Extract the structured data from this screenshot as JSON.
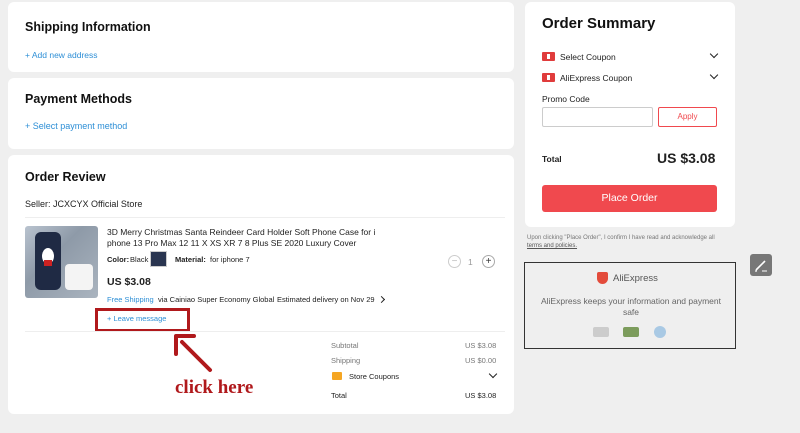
{
  "shipping": {
    "title": "Shipping Information",
    "add_address": "+ Add new address"
  },
  "payment": {
    "title": "Payment Methods",
    "select_method": "+ Select payment method"
  },
  "review": {
    "title": "Order Review",
    "seller": "Seller: JCXCYX Official Store",
    "product": {
      "title_line1": "3D Merry Christmas Santa Reindeer Card Holder Soft Phone Case for i",
      "title_line2": "phone 13 Pro Max 12 11 X XS XR 7 8 Plus SE 2020 Luxury Cover",
      "color_label": "Color:",
      "color_value": "Black",
      "material_label": "Material:",
      "material_value": "for iphone 7",
      "price": "US $3.08",
      "free_shipping": "Free Shipping",
      "shipping_via": "via Cainiao Super Economy Global",
      "delivery": "Estimated delivery on Nov 29",
      "quantity": "1",
      "minus": "−",
      "plus": "+"
    },
    "leave_message": "+ Leave message",
    "annotation": "click here",
    "totals": {
      "subtotal_label": "Subtotal",
      "subtotal_value": "US $3.08",
      "shipping_label": "Shipping",
      "shipping_value": "US $0.00",
      "store_coupons": "Store Coupons",
      "total_label": "Total",
      "total_value": "US $3.08"
    }
  },
  "summary": {
    "title": "Order Summary",
    "select_coupon": "Select Coupon",
    "aliexpress_coupon": "AliExpress Coupon",
    "promo_label": "Promo Code",
    "promo_value": "",
    "apply": "Apply",
    "total_label": "Total",
    "total_value": "US $3.08",
    "place_order": "Place Order",
    "disclaimer_line1": "Upon clicking \"Place Order\", I confirm I have read and acknowledge all",
    "disclaimer_link": "terms and policies."
  },
  "trust": {
    "brand": "AliExpress",
    "line1": "AliExpress keeps your information and payment",
    "line2": "safe"
  },
  "colors": {
    "accent": "#f0494e",
    "link": "#2e8fd6",
    "annotation": "#b0191c"
  }
}
